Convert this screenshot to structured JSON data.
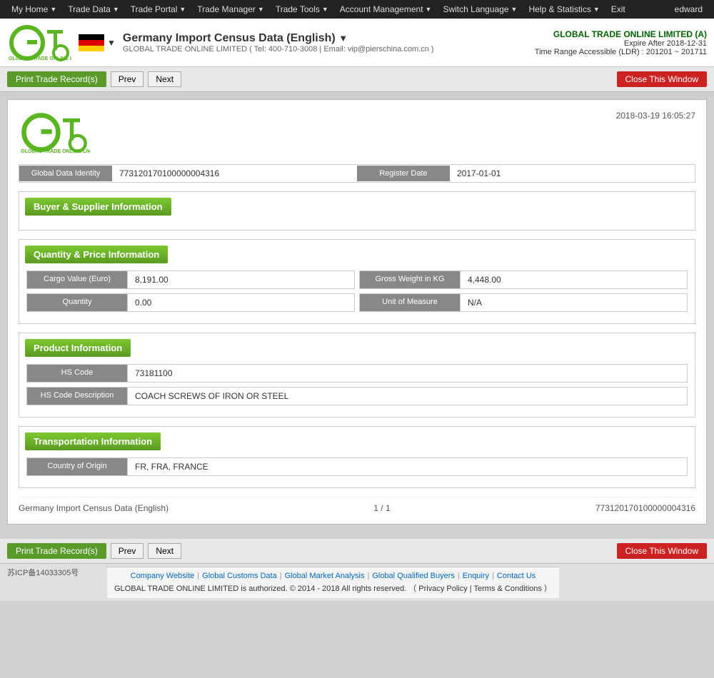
{
  "topnav": {
    "items": [
      {
        "label": "My Home",
        "id": "my-home"
      },
      {
        "label": "Trade Data",
        "id": "trade-data"
      },
      {
        "label": "Trade Portal",
        "id": "trade-portal"
      },
      {
        "label": "Trade Manager",
        "id": "trade-manager"
      },
      {
        "label": "Trade Tools",
        "id": "trade-tools"
      },
      {
        "label": "Account Management",
        "id": "account-management"
      },
      {
        "label": "Switch Language",
        "id": "switch-language"
      },
      {
        "label": "Help & Statistics",
        "id": "help-statistics"
      },
      {
        "label": "Exit",
        "id": "exit"
      }
    ],
    "user": "edward"
  },
  "header": {
    "title": "Germany Import Census Data (English)",
    "company_contact": "GLOBAL TRADE ONLINE LIMITED ( Tel: 400-710-3008 | Email: vip@pierschina.com.cn )",
    "company_name": "GLOBAL TRADE ONLINE LIMITED (A)",
    "expire": "Expire After 2018-12-31",
    "time_range": "Time Range Accessible (LDR) : 201201 ~ 201711"
  },
  "actions": {
    "print_label": "Print Trade Record(s)",
    "prev_label": "Prev",
    "next_label": "Next",
    "close_label": "Close This Window"
  },
  "record": {
    "date": "2018-03-19 16:05:27",
    "global_data_identity": {
      "label": "Global Data Identity",
      "value": "773120170100000004316"
    },
    "register_date": {
      "label": "Register Date",
      "value": "2017-01-01"
    },
    "sections": {
      "buyer_supplier": {
        "title": "Buyer & Supplier Information",
        "fields": []
      },
      "quantity_price": {
        "title": "Quantity & Price Information",
        "fields": [
          {
            "label": "Cargo Value (Euro)",
            "value": "8,191.00"
          },
          {
            "label": "Gross Weight in KG",
            "value": "4,448.00"
          },
          {
            "label": "Quantity",
            "value": "0.00"
          },
          {
            "label": "Unit of Measure",
            "value": "N/A"
          }
        ]
      },
      "product": {
        "title": "Product Information",
        "fields": [
          {
            "label": "HS Code",
            "value": "73181100"
          },
          {
            "label": "HS Code Description",
            "value": "COACH SCREWS OF IRON OR STEEL"
          }
        ]
      },
      "transportation": {
        "title": "Transportation Information",
        "fields": [
          {
            "label": "Country of Origin",
            "value": "FR, FRA, FRANCE"
          }
        ]
      }
    },
    "footer": {
      "left": "Germany Import Census Data (English)",
      "center": "1 / 1",
      "right": "773120170100000004316"
    }
  },
  "bottom_footer": {
    "links": [
      "Company Website",
      "Global Customs Data",
      "Global Market Analysis",
      "Global Qualified Buyers",
      "Enquiry",
      "Contact Us"
    ],
    "copyright": "GLOBAL TRADE ONLINE LIMITED is authorized. © 2014 - 2018 All rights reserved.  （ Privacy Policy | Terms & Conditions ）"
  },
  "icp": {
    "text": "苏ICP备14033305号"
  }
}
